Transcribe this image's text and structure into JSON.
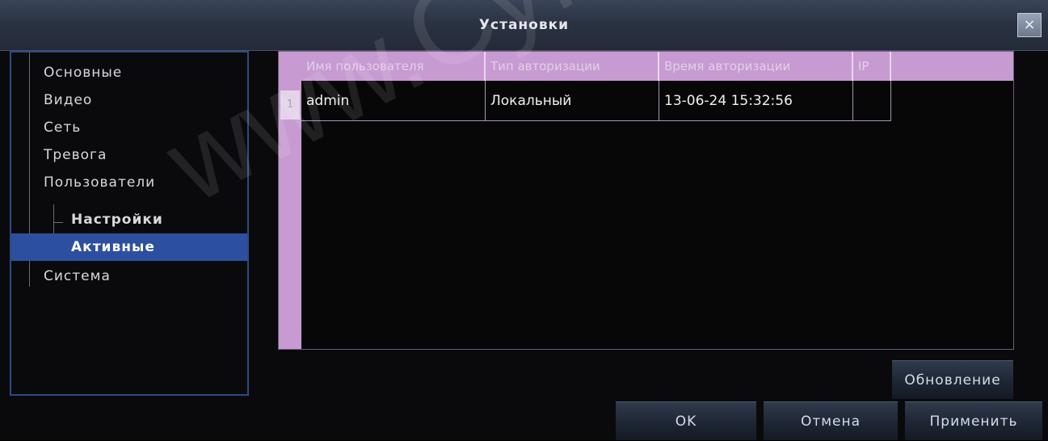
{
  "window": {
    "title": "Установки",
    "close_label": "×"
  },
  "tree": {
    "items": [
      {
        "label": "Основные",
        "level": 0,
        "active": false
      },
      {
        "label": "Видео",
        "level": 0,
        "active": false
      },
      {
        "label": "Сеть",
        "level": 0,
        "active": false
      },
      {
        "label": "Тревога",
        "level": 0,
        "active": false
      },
      {
        "label": "Пользователи",
        "level": 0,
        "active": false
      },
      {
        "label": "Настройки",
        "level": 1,
        "active": false
      },
      {
        "label": "Активные",
        "level": 1,
        "active": true
      },
      {
        "label": "Система",
        "level": 0,
        "active": false
      }
    ]
  },
  "table": {
    "columns": [
      "Имя пользователя",
      "Тип авторизации",
      "Время авторизации",
      "IP"
    ],
    "rows": [
      {
        "num": "1",
        "cells": [
          "admin",
          "Локальный",
          "13-06-24 15:32:56",
          ""
        ]
      }
    ]
  },
  "buttons": {
    "refresh": "Обновление",
    "ok": "OK",
    "cancel": "Отмена",
    "apply": "Применить"
  },
  "watermark": "www.Cyfron.ru",
  "colors": {
    "header_bg": "#c79bd2",
    "active_item": "#2d4fa0",
    "tree_border": "#2c4a86"
  }
}
